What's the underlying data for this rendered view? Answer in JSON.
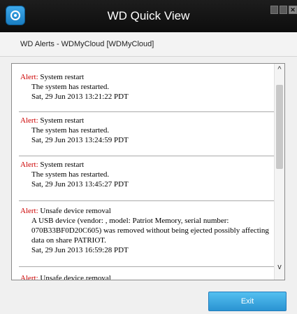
{
  "window": {
    "title": "WD Quick View"
  },
  "subheader": {
    "text": "WD Alerts - WDMyCloud [WDMyCloud]"
  },
  "alerts": [
    {
      "label": "Alert:",
      "title": "System restart",
      "lines": [
        "The system has restarted.",
        "Sat, 29 Jun 2013 13:21:22 PDT"
      ]
    },
    {
      "label": "Alert:",
      "title": "System restart",
      "lines": [
        "The system has restarted.",
        "Sat, 29 Jun 2013 13:24:59 PDT"
      ]
    },
    {
      "label": "Alert:",
      "title": "System restart",
      "lines": [
        "The system has restarted.",
        "Sat, 29 Jun 2013 13:45:27 PDT"
      ]
    },
    {
      "label": "Alert:",
      "title": "Unsafe device removal",
      "lines": [
        "A USB device (vendor: , model: Patriot Memory, serial number: 070B33BF0D20C605) was removed without being ejected possibly affecting data on share PATRIOT.",
        "Sat, 29 Jun 2013 16:59:28 PDT"
      ]
    },
    {
      "label": "Alert:",
      "title": "Unsafe device removal",
      "lines": []
    }
  ],
  "footer": {
    "exit_label": "Exit"
  },
  "colors": {
    "alert_label": "#cc0000",
    "exit_button": "#2a93d2",
    "titlebar": "#111111"
  },
  "icons": {
    "logo": "wd-quick-view-logo-icon",
    "scroll_up": "chevron-up-icon",
    "scroll_down": "chevron-down-icon"
  }
}
